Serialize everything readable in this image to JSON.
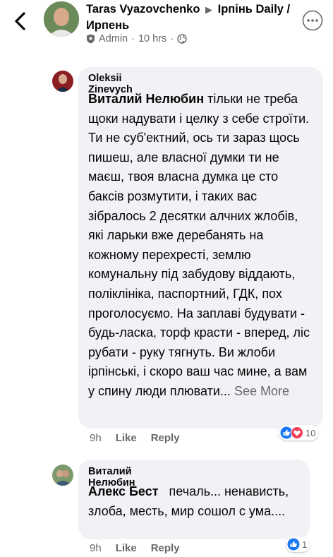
{
  "header": {
    "author": "Taras Vyazovchenko",
    "group": "Ірпінь Daily / Ирпень",
    "role": "Admin",
    "time": "10 hrs",
    "separator": "·"
  },
  "comments": [
    {
      "author": "Oleksii Zinevych",
      "mention": "Виталий Нелюбин",
      "text": " тільки не треба щоки надувати і целку з себе строїти. Ти не суб'ектний, ось ти зараз щось пишеш, але власної думки ти не маєш, твоя власна думка це сто баксів розмутити, і таких вас зібралось 2 десятки алчних жлобів, які ларьки вже деребанять на кожному перехресті, землю комунальну під забудову віддають, поліклініка, паспортний, ГДК, пох проголосуємо. На заплаві будувати - будь-ласка, торф красти - вперед, ліс рубати - руку тягнуть. Ви жлоби ірпінські, і скоро ваш час мине, а вам у спину люди плювати...",
      "see_more": "See More",
      "time": "9h",
      "like": "Like",
      "reply": "Reply",
      "reactions": "10"
    },
    {
      "author": "Виталий Нелюбин",
      "mention": "Алекс Бест",
      "text": "   печаль... ненависть,    злоба, месть, мир сошол с ума....",
      "time": "9h",
      "like": "Like",
      "reply": "Reply",
      "reactions": "1"
    }
  ],
  "colors": {
    "like_blue": "#1877f2",
    "love_red": "#f33e58",
    "bubble": "#f0f2f5",
    "muted": "#65676b"
  }
}
